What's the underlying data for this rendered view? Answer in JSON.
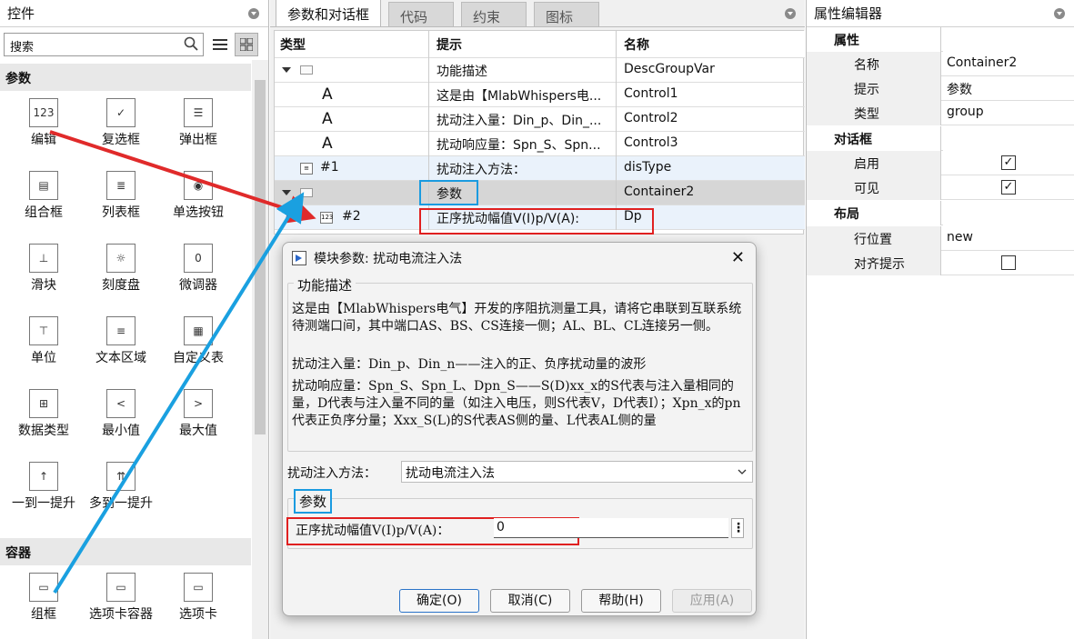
{
  "left": {
    "title": "控件",
    "search_placeholder": "搜索",
    "sections": [
      "参数",
      "容器"
    ],
    "widgets": [
      {
        "label": "编辑",
        "icon": "edit-123-icon",
        "glyph": "123"
      },
      {
        "label": "复选框",
        "icon": "checkbox-icon",
        "glyph": "✓"
      },
      {
        "label": "弹出框",
        "icon": "popup-icon",
        "glyph": "☰"
      },
      {
        "label": "组合框",
        "icon": "combobox-icon",
        "glyph": "▤"
      },
      {
        "label": "列表框",
        "icon": "listbox-icon",
        "glyph": "≣"
      },
      {
        "label": "单选按钮",
        "icon": "radio-button-icon",
        "glyph": "◉"
      },
      {
        "label": "滑块",
        "icon": "slider-icon",
        "glyph": "⊥"
      },
      {
        "label": "刻度盘",
        "icon": "dial-icon",
        "glyph": "☼"
      },
      {
        "label": "微调器",
        "icon": "spinner-icon",
        "glyph": "0"
      },
      {
        "label": "单位",
        "icon": "unit-icon",
        "glyph": "⊤"
      },
      {
        "label": "文本区域",
        "icon": "text-area-icon",
        "glyph": "≡"
      },
      {
        "label": "自定义表",
        "icon": "custom-table-icon",
        "glyph": "▦"
      },
      {
        "label": "数据类型",
        "icon": "data-type-icon",
        "glyph": "⊞"
      },
      {
        "label": "最小值",
        "icon": "min-value-icon",
        "glyph": "<"
      },
      {
        "label": "最大值",
        "icon": "max-value-icon",
        "glyph": ">"
      },
      {
        "label": "一到一提升",
        "icon": "promote-one-icon",
        "glyph": "↑"
      },
      {
        "label": "多到一提升",
        "icon": "promote-many-icon",
        "glyph": "⇈"
      }
    ],
    "container_widgets": [
      {
        "label": "组框",
        "icon": "group-box-icon",
        "glyph": "▭"
      },
      {
        "label": "选项卡容器",
        "icon": "tab-container-icon",
        "glyph": "▭"
      },
      {
        "label": "选项卡",
        "icon": "tab-icon",
        "glyph": "▭"
      }
    ]
  },
  "tabs": [
    "参数和对话框",
    "代码",
    "约束",
    "图标"
  ],
  "grid": {
    "headers": [
      "类型",
      "提示",
      "名称"
    ],
    "rows": [
      {
        "type": "",
        "prompt": "功能描述",
        "name": "DescGroupVar"
      },
      {
        "type": "A",
        "prompt": "这是由【MlabWhispers电...",
        "name": "Control1"
      },
      {
        "type": "A",
        "prompt": "扰动注入量：Din_p、Din_...",
        "name": "Control2"
      },
      {
        "type": "A",
        "prompt": "扰动响应量：Spn_S、Spn...",
        "name": "Control3"
      },
      {
        "type": "#1",
        "prompt": "扰动注入方法：",
        "name": "disType"
      },
      {
        "type": "",
        "prompt": "参数",
        "name": "Container2"
      },
      {
        "type": "#2",
        "prompt": "正序扰动幅值V(I)p/V(A):",
        "name": "Dp"
      }
    ]
  },
  "dialog": {
    "title": "模块参数: 扰动电流注入法",
    "legend": "功能描述",
    "desc1": "这是由【MlabWhispers电气】开发的序阻抗测量工具，请将它串联到互联系统待测端口间，其中端口AS、BS、CS连接一侧；AL、BL、CL连接另一侧。",
    "desc2": "扰动注入量：Din_p、Din_n——注入的正、负序扰动量的波形",
    "desc3": "扰动响应量：Spn_S、Spn_L、Dpn_S——S(D)xx_x的S代表与注入量相同的量，D代表与注入量不同的量（如注入电压，则S代表V，D代表I）；Xpn_x的pn代表正负序分量；Xxx_S(L)的S代表AS侧的量、L代表AL侧的量",
    "method_label": "扰动注入方法：",
    "method_value": "扰动电流注入法",
    "param_legend": "参数",
    "param_label": "正序扰动幅值V(I)p/V(A)：",
    "param_value": "0",
    "buttons": {
      "ok": "确定(O)",
      "cancel": "取消(C)",
      "help": "帮助(H)",
      "apply": "应用(A)"
    }
  },
  "right": {
    "title": "属性编辑器",
    "cats": {
      "props": "属性",
      "dialog": "对话框",
      "layout": "布局"
    },
    "rows": {
      "name_k": "名称",
      "name_v": "Container2",
      "prompt_k": "提示",
      "prompt_v": "参数",
      "type_k": "类型",
      "type_v": "group",
      "enable_k": "启用",
      "enable_v": "✓",
      "visible_k": "可见",
      "visible_v": "✓",
      "rowpos_k": "行位置",
      "rowpos_v": "new",
      "align_k": "对齐提示",
      "align_v": ""
    }
  },
  "colors": {
    "red_box": "#e02020",
    "blue_box": "#1a9be0",
    "red_arrow": "#e02a2a",
    "blue_arrow": "#1aa0e0"
  }
}
